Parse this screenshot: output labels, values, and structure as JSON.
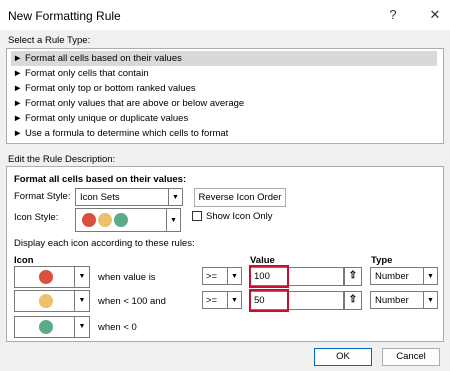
{
  "window": {
    "title": "New Formatting Rule",
    "help_glyph": "?",
    "close_glyph": "✕"
  },
  "rule_type": {
    "label": "Select a Rule Type:",
    "items": [
      {
        "label": "► Format all cells based on their values",
        "selected": true
      },
      {
        "label": "► Format only cells that contain"
      },
      {
        "label": "► Format only top or bottom ranked values"
      },
      {
        "label": "► Format only values that are above or below average"
      },
      {
        "label": "► Format only unique or duplicate values"
      },
      {
        "label": "► Use a formula to determine which cells to format"
      }
    ]
  },
  "description": {
    "label": "Edit the Rule Description:",
    "heading": "Format all cells based on their values:",
    "format_style_label": "Format Style:",
    "format_style_value": "Icon Sets",
    "reverse_button": "Reverse Icon Order",
    "icon_style_label": "Icon Style:",
    "show_icon_only": "Show Icon Only",
    "display_rules_text": "Display each icon according to these rules:",
    "col_icon": "Icon",
    "col_value": "Value",
    "col_type": "Type",
    "icon_colors": [
      "#d9503f",
      "#edc06e",
      "#5bab8a"
    ],
    "rows": [
      {
        "condition": "when value is",
        "operator": ">=",
        "value": "100",
        "type": "Number",
        "color": "#d9503f"
      },
      {
        "condition": "when < 100 and",
        "operator": ">=",
        "value": "50",
        "type": "Number",
        "color": "#edc06e"
      },
      {
        "condition": "when < 0",
        "color": "#5bab8a"
      }
    ]
  },
  "footer": {
    "ok": "OK",
    "cancel": "Cancel"
  }
}
